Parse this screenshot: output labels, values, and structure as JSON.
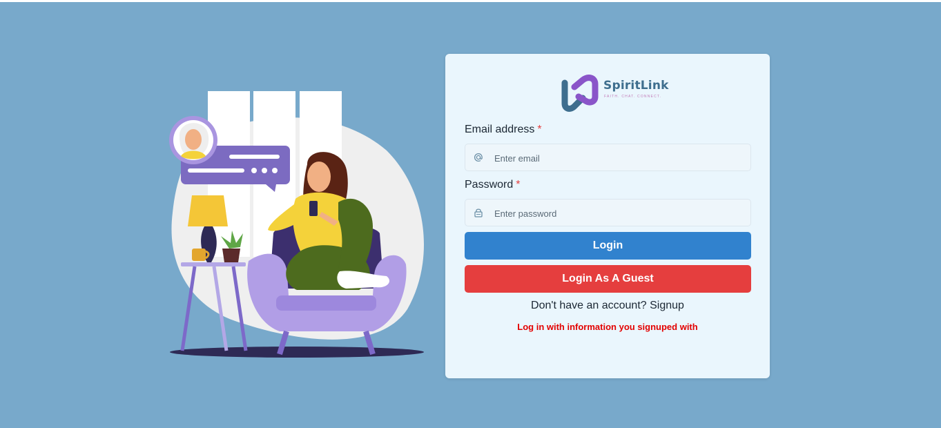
{
  "brand": {
    "name": "SpiritLink",
    "tagline": "FAITH. CHAT. CONNECT.",
    "colors": {
      "primary": "#3e6e8e",
      "accent": "#8a55c9"
    }
  },
  "page": {
    "background": "#78a9cb"
  },
  "illustration": {
    "description_icon": "woman-on-armchair-chatting-illustration"
  },
  "form": {
    "email": {
      "label": "Email address",
      "required_mark": "*",
      "placeholder": "Enter email",
      "icon": "at-sign-icon"
    },
    "password": {
      "label": "Password",
      "required_mark": "*",
      "placeholder": "Enter password",
      "icon": "lock-icon"
    },
    "login_button": {
      "label": "Login",
      "color": "#3182ce"
    },
    "guest_button": {
      "label": "Login As A Guest",
      "color": "#e53e3e"
    },
    "signup": {
      "prompt": "Don't have an account?",
      "link": "Signup"
    },
    "hint": "Log in with information you signuped with"
  }
}
